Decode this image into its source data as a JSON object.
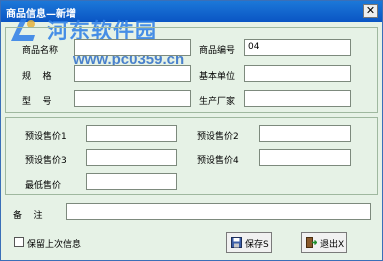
{
  "window": {
    "title": "商品信息—新增",
    "close_glyph": "✕"
  },
  "watermark": {
    "chinese": "河东软件园",
    "url": "www.pc0359.cn"
  },
  "form": {
    "name_label": "商品名称",
    "name_value": "",
    "code_label": "商品编号",
    "code_value": "04",
    "spec_label": "规    格",
    "spec_value": "",
    "unit_label": "基本单位",
    "unit_value": "",
    "model_label": "型    号",
    "model_value": "",
    "maker_label": "生产厂家",
    "maker_value": ""
  },
  "prices": {
    "p1_label": "预设售价1",
    "p1_value": "",
    "p2_label": "预设售价2",
    "p2_value": "",
    "p3_label": "预设售价3",
    "p3_value": "",
    "p4_label": "预设售价4",
    "p4_value": "",
    "min_label": "最低售价",
    "min_value": ""
  },
  "remark": {
    "label": "备    注",
    "value": ""
  },
  "keep_last": {
    "label": "保留上次信息",
    "checked": false
  },
  "buttons": {
    "save_label": "保存S",
    "exit_label": "退出X"
  }
}
